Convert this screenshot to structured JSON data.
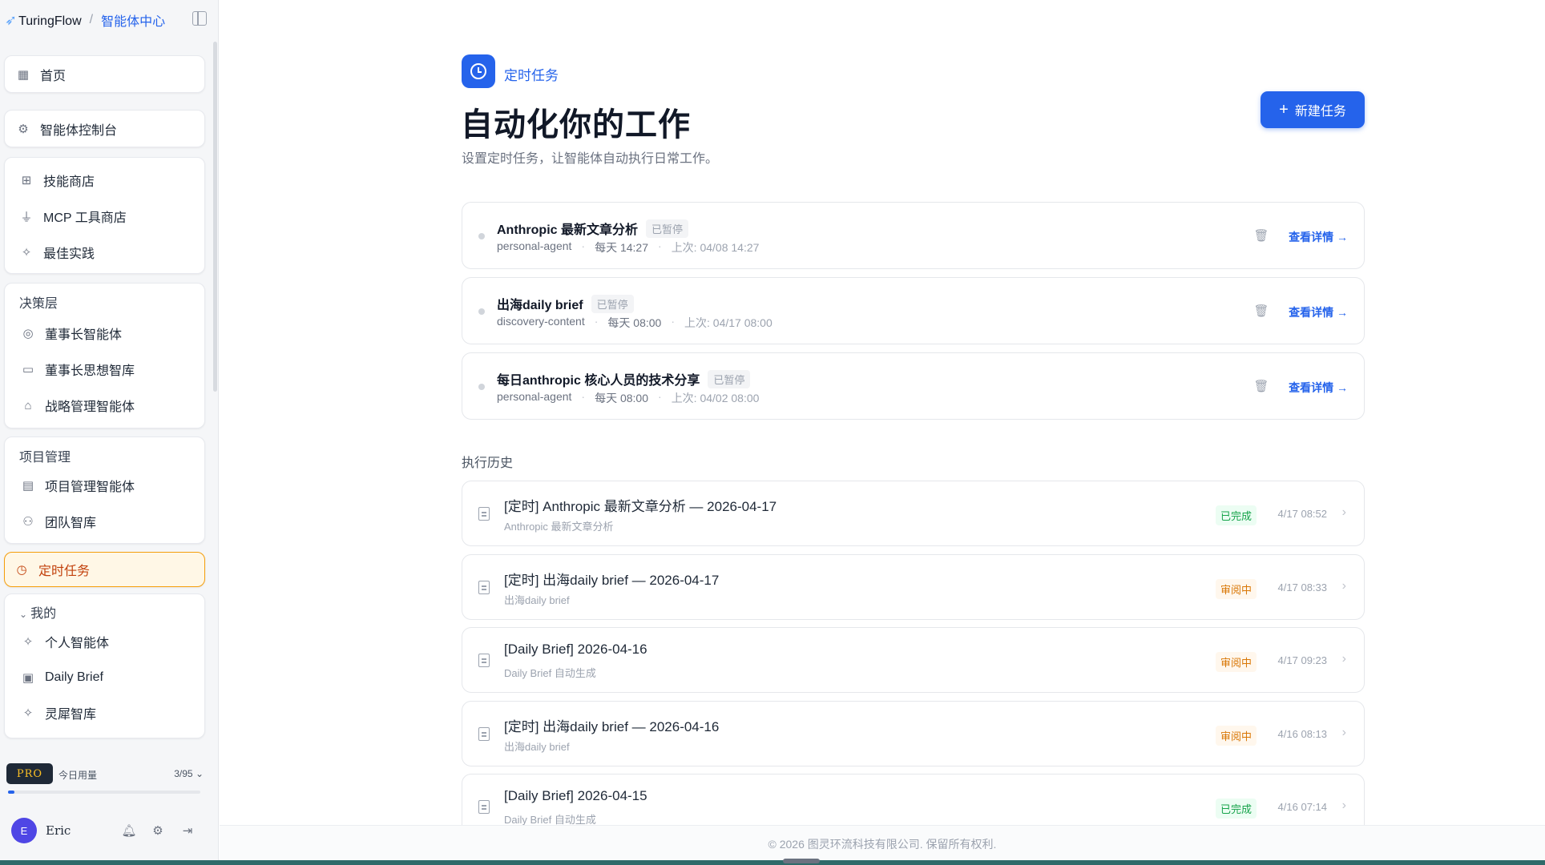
{
  "brand": {
    "logo": "TuringFlow",
    "separator": "/",
    "section": "智能体中心"
  },
  "sidebar": {
    "home": "首页",
    "console": "智能体控制台",
    "store_items": [
      "技能商店",
      "MCP 工具商店",
      "最佳实践"
    ],
    "decision": {
      "title": "决策层",
      "items": [
        "董事长智能体",
        "董事长思想智库",
        "战略管理智能体"
      ]
    },
    "project": {
      "title": "项目管理",
      "items": [
        "项目管理智能体",
        "团队智库"
      ]
    },
    "active_item": "定时任务",
    "mine": {
      "title": "我的",
      "items": [
        "个人智能体",
        "Daily Brief",
        "灵犀智库"
      ]
    },
    "usage": {
      "badge": "PRO",
      "label": "今日用量",
      "count": "3/95",
      "fraction": 0.032
    },
    "user": {
      "initial": "E",
      "name": "Eric"
    }
  },
  "header": {
    "kicker": "定时任务",
    "title": "自动化你的工作",
    "subtitle": "设置定时任务，让智能体自动执行日常工作。",
    "new_button": "新建任务"
  },
  "tasks": [
    {
      "name": "Anthropic 最新文章分析",
      "badge": "已暂停",
      "agent": "personal-agent",
      "schedule": "每天 14:27",
      "last": "上次: 04/08 14:27",
      "detail": "查看详情 →"
    },
    {
      "name": "出海daily brief",
      "badge": "已暂停",
      "agent": "discovery-content",
      "schedule": "每天 08:00",
      "last": "上次: 04/17 08:00",
      "detail": "查看详情 →"
    },
    {
      "name": "每日anthropic 核心人员的技术分享",
      "badge": "已暂停",
      "agent": "personal-agent",
      "schedule": "每天 08:00",
      "last": "上次: 04/02 08:00",
      "detail": "查看详情 →"
    }
  ],
  "history": {
    "title": "执行历史",
    "items": [
      {
        "title": "[定时] Anthropic 最新文章分析 — 2026-04-17",
        "sub": "Anthropic 最新文章分析",
        "status": "已完成",
        "time": "4/17 08:52"
      },
      {
        "title": "[定时] 出海daily brief — 2026-04-17",
        "sub": "出海daily brief",
        "status": "审阅中",
        "time": "4/17 08:33"
      },
      {
        "title": "[Daily Brief] 2026-04-16",
        "sub": "Daily Brief 自动生成",
        "status": "审阅中",
        "time": "4/17 09:23"
      },
      {
        "title": "[定时] 出海daily brief — 2026-04-16",
        "sub": "出海daily brief",
        "status": "审阅中",
        "time": "4/16 08:13"
      },
      {
        "title": "[Daily Brief] 2026-04-15",
        "sub": "Daily Brief 自动生成",
        "status": "已完成",
        "time": "4/16 07:14"
      }
    ]
  },
  "footer": {
    "copyright": "© 2026 图灵环流科技有限公司. 保留所有权利."
  },
  "colors": {
    "accent": "#2563eb",
    "active": "#f59e0b",
    "done": "#16a34a",
    "review": "#d97706"
  }
}
